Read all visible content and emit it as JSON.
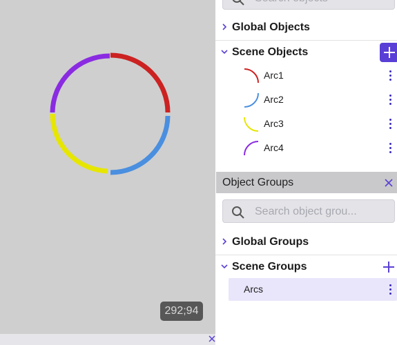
{
  "viewport": {
    "coordinates": "292;94"
  },
  "objects_panel": {
    "search_placeholder": "Search objects",
    "global_label": "Global Objects",
    "scene_label": "Scene Objects",
    "items": [
      {
        "label": "Arc1",
        "color": "#cc2222"
      },
      {
        "label": "Arc2",
        "color": "#4a8fe0"
      },
      {
        "label": "Arc3",
        "color": "#e6e600"
      },
      {
        "label": "Arc4",
        "color": "#8a2be2"
      }
    ]
  },
  "groups_panel": {
    "title": "Object Groups",
    "search_placeholder": "Search object grou...",
    "global_label": "Global Groups",
    "scene_label": "Scene Groups",
    "items": [
      {
        "label": "Arcs"
      }
    ]
  },
  "accent_color": "#5a3fd6"
}
